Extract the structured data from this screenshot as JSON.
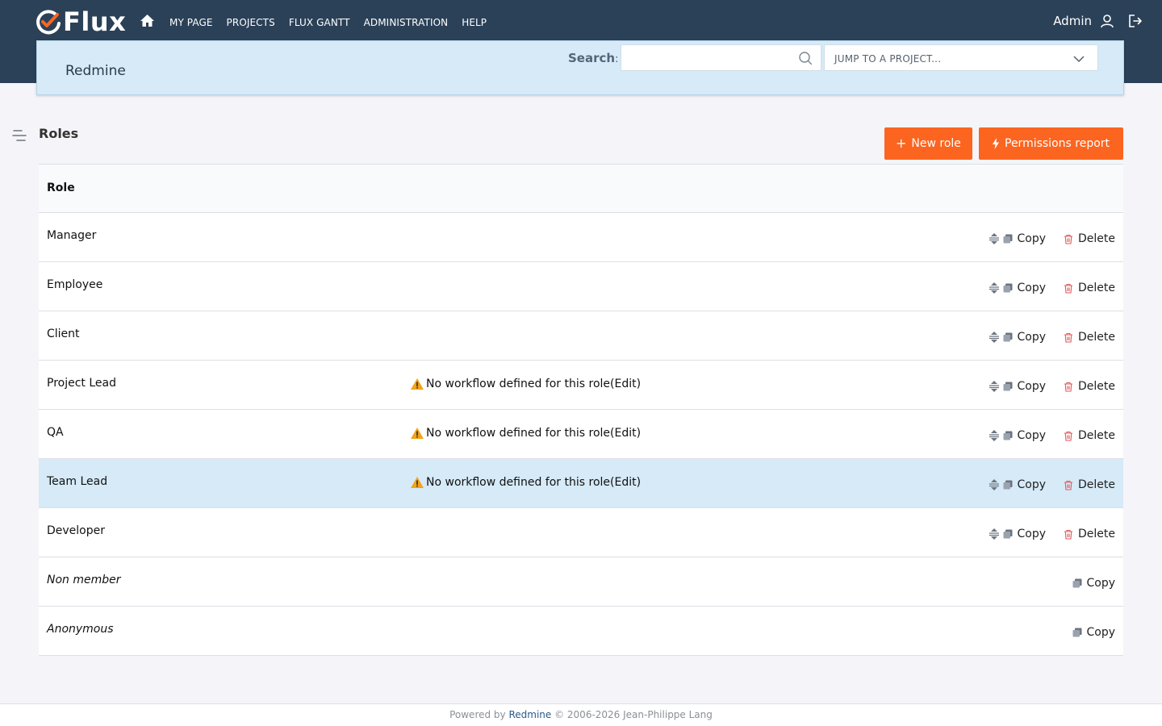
{
  "brand": {
    "name": "Flux",
    "accent": "#fb6520",
    "header_bg": "#2b4158"
  },
  "topnav": {
    "items": [
      "MY PAGE",
      "PROJECTS",
      "FLUX GANTT",
      "ADMINISTRATION",
      "HELP"
    ]
  },
  "user": {
    "name": "Admin"
  },
  "subheader": {
    "site_title": "Redmine",
    "search_label": "Search",
    "search_colon": ":",
    "search_value": "",
    "jump_placeholder": "JUMP TO A PROJECT..."
  },
  "page": {
    "title": "Roles"
  },
  "buttons": {
    "new_role": "New role",
    "permissions_report": "Permissions report"
  },
  "table": {
    "header": "Role",
    "warning_text": "No workflow defined for this role",
    "warning_edit": "(Edit)",
    "copy_label": "Copy",
    "delete_label": "Delete",
    "rows": [
      {
        "name": "Manager"
      },
      {
        "name": "Employee"
      },
      {
        "name": "Client"
      },
      {
        "name": "Project Lead"
      },
      {
        "name": "QA"
      },
      {
        "name": "Team Lead"
      },
      {
        "name": "Developer"
      },
      {
        "name": "Non member"
      },
      {
        "name": "Anonymous"
      }
    ]
  },
  "footer": {
    "prefix": "Powered by ",
    "link": "Redmine",
    "suffix": " © 2006-2026 Jean-Philippe Lang"
  }
}
